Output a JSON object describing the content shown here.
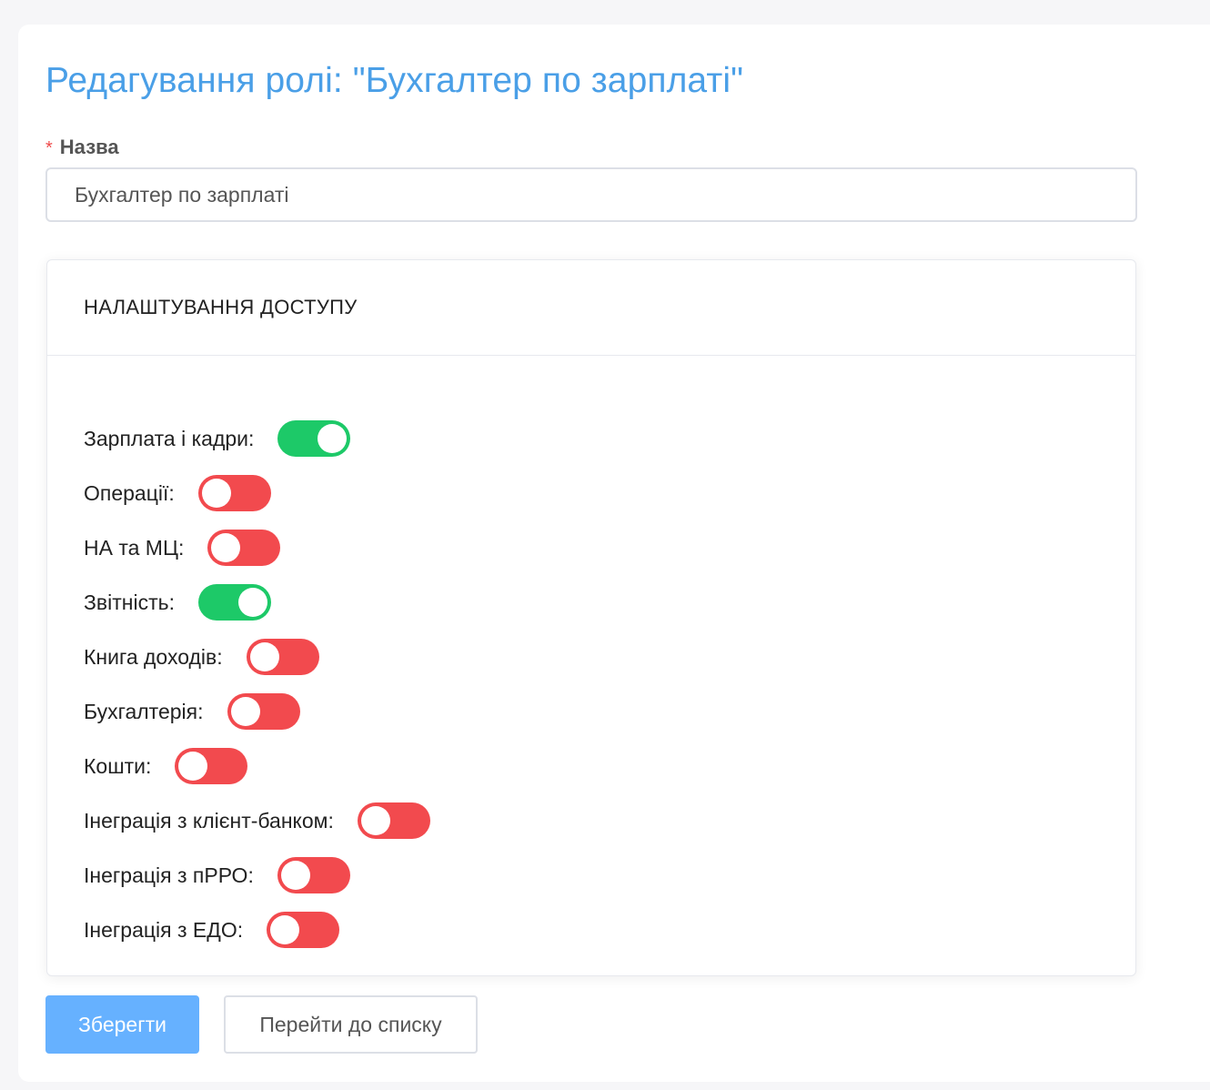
{
  "page": {
    "title": "Редагування ролі: \"Бухгалтер по зарплаті\""
  },
  "form": {
    "name_label": "Назва",
    "required_mark": "*",
    "name_value": "Бухгалтер по зарплаті"
  },
  "access": {
    "title": "НАЛАШТУВАННЯ ДОСТУПУ",
    "permissions": [
      {
        "label": "Зарплата і кадри:",
        "enabled": true
      },
      {
        "label": "Операції:",
        "enabled": false
      },
      {
        "label": "НА та МЦ:",
        "enabled": false
      },
      {
        "label": "Звітність:",
        "enabled": true
      },
      {
        "label": "Книга доходів:",
        "enabled": false
      },
      {
        "label": "Бухгалтерія:",
        "enabled": false
      },
      {
        "label": "Кошти:",
        "enabled": false
      },
      {
        "label": "Інеграція з клієнт-банком:",
        "enabled": false
      },
      {
        "label": "Інеграція з пРРО:",
        "enabled": false
      },
      {
        "label": "Інеграція з ЕДО:",
        "enabled": false
      }
    ]
  },
  "actions": {
    "save_label": "Зберегти",
    "list_label": "Перейти до списку"
  },
  "colors": {
    "title": "#4a9fe7",
    "toggle_on": "#1dc968",
    "toggle_off": "#f24a4e",
    "primary_button": "#66b1ff",
    "required": "#ef4b4b"
  }
}
